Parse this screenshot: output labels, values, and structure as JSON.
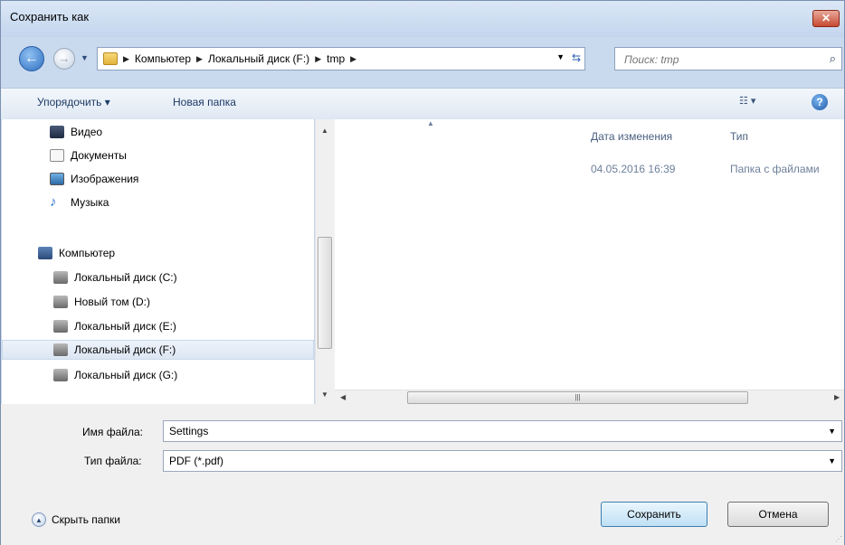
{
  "window": {
    "title": "Сохранить как",
    "close_label": "✕"
  },
  "address": {
    "crumbs": [
      "Компьютер",
      "Локальный диск (F:)",
      "tmp"
    ],
    "search_placeholder": "Поиск: tmp"
  },
  "toolbar": {
    "organize_label": "Упорядочить ▾",
    "new_folder_label": "Новая папка",
    "help_label": "?"
  },
  "nav": {
    "items": [
      {
        "label": "Видео",
        "icon": "video-icon"
      },
      {
        "label": "Документы",
        "icon": "documents-icon"
      },
      {
        "label": "Изображения",
        "icon": "pictures-icon"
      },
      {
        "label": "Музыка",
        "icon": "music-icon"
      },
      {
        "label": "Компьютер",
        "icon": "computer-icon"
      },
      {
        "label": "Локальный диск (C:)",
        "icon": "drive-icon"
      },
      {
        "label": "Новый том (D:)",
        "icon": "drive-icon"
      },
      {
        "label": "Локальный диск (E:)",
        "icon": "drive-icon"
      },
      {
        "label": "Локальный диск (F:)",
        "icon": "drive-icon",
        "selected": true
      },
      {
        "label": "Локальный диск (G:)",
        "icon": "drive-icon"
      }
    ]
  },
  "files": {
    "columns": {
      "date": "Дата изменения",
      "type": "Тип"
    },
    "rows": [
      {
        "date": "04.05.2016 16:39",
        "type": "Папка с файлами"
      }
    ]
  },
  "form": {
    "filename_label": "Имя файла:",
    "filename_value": "Settings",
    "filetype_label": "Тип файла:",
    "filetype_value": "PDF (*.pdf)"
  },
  "footer": {
    "hide_folders_label": "Скрыть папки",
    "save_label": "Сохранить",
    "cancel_label": "Отмена"
  },
  "colors": {
    "accent": "#3c7fb1",
    "close": "#c64a33"
  }
}
